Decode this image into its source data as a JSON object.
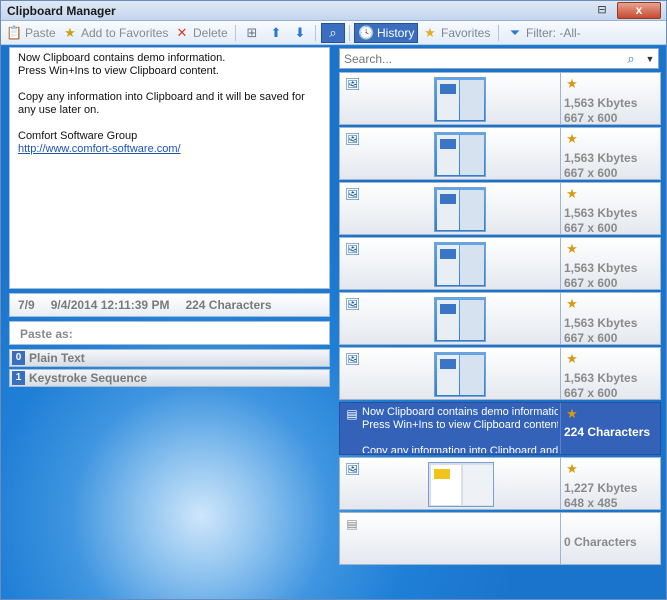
{
  "window": {
    "title": "Clipboard Manager",
    "pin_icon": "pin-icon",
    "close_icon": "close-icon",
    "close_glyph": "x"
  },
  "toolbar": {
    "paste": "Paste",
    "add_favorites": "Add to Favorites",
    "delete": "Delete",
    "history": "History",
    "favorites": "Favorites",
    "filter": "Filter: -All-"
  },
  "preview": {
    "lines": "Now Clipboard contains demo information.\nPress Win+Ins to view Clipboard content.\n\nCopy any information into Clipboard and it will be saved for any use later on.\n\nComfort Software Group",
    "link": "http://www.comfort-software.com/"
  },
  "info": {
    "position": "7/9",
    "datetime": "9/4/2014 12:11:39 PM",
    "chars": "224 Characters"
  },
  "paste_as": {
    "label": "Paste as:",
    "options": [
      {
        "num": "0",
        "label": "Plain Text"
      },
      {
        "num": "1",
        "label": "Keystroke Sequence"
      }
    ]
  },
  "search": {
    "placeholder": "Search..."
  },
  "history": [
    {
      "kind": "image",
      "size": "1,563 Kbytes",
      "dims": "667 x 600"
    },
    {
      "kind": "image",
      "size": "1,563 Kbytes",
      "dims": "667 x 600"
    },
    {
      "kind": "image",
      "size": "1,563 Kbytes",
      "dims": "667 x 600"
    },
    {
      "kind": "image",
      "size": "1,563 Kbytes",
      "dims": "667 x 600"
    },
    {
      "kind": "image",
      "size": "1,563 Kbytes",
      "dims": "667 x 600"
    },
    {
      "kind": "image",
      "size": "1,563 Kbytes",
      "dims": "667 x 600"
    },
    {
      "kind": "text",
      "preview": "Now Clipboard contains demo information.\nPress Win+Ins to view Clipboard content.\n\nCopy any information into Clipboard and",
      "chars": "224 Characters"
    },
    {
      "kind": "image",
      "size": "1,227 Kbytes",
      "dims": "648 x 485"
    },
    {
      "kind": "text-empty",
      "chars": "0 Characters"
    }
  ],
  "colors": {
    "accent": "#3362b8",
    "background": "#1e7fd6"
  }
}
